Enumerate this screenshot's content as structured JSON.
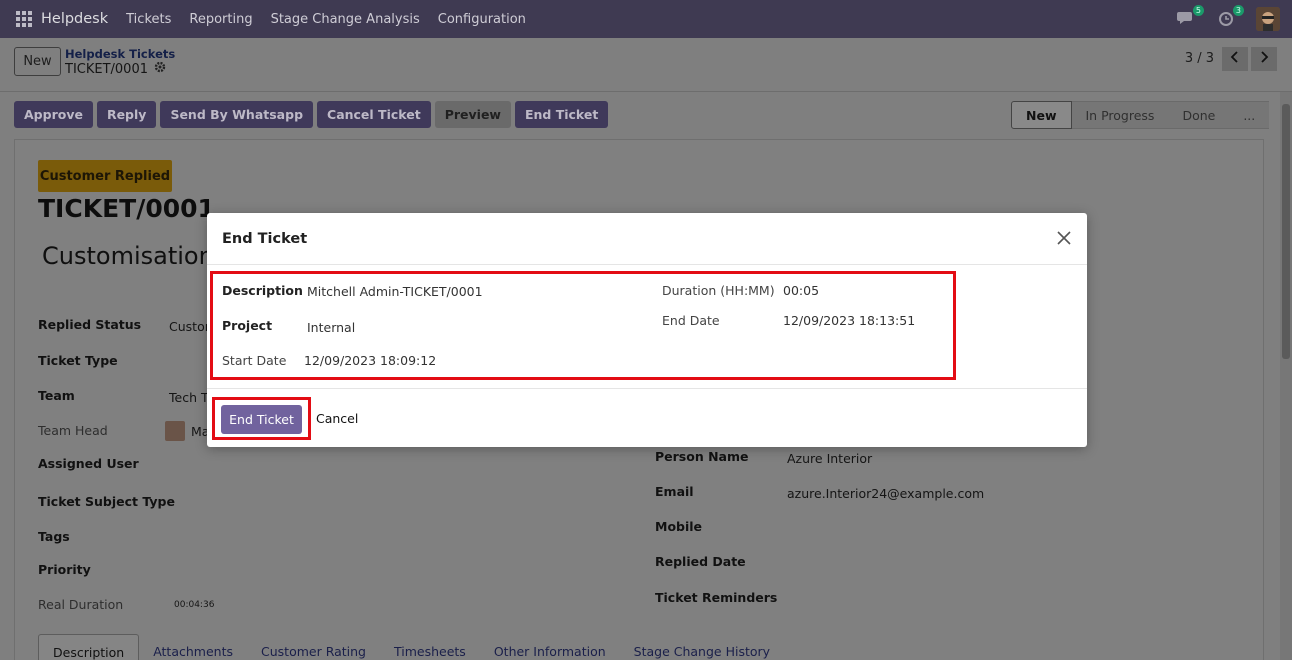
{
  "navbar": {
    "app_name": "Helpdesk",
    "menu": [
      "Tickets",
      "Reporting",
      "Stage Change Analysis",
      "Configuration"
    ],
    "chat_badge": "5",
    "activity_badge": "3"
  },
  "control_panel": {
    "new_label": "New",
    "breadcrumb_parent": "Helpdesk Tickets",
    "breadcrumb_current": "TICKET/0001",
    "pager": "3 / 3"
  },
  "actions": [
    "Approve",
    "Reply",
    "Send By Whatsapp",
    "Cancel Ticket",
    "Preview",
    "End Ticket"
  ],
  "stages": [
    "New",
    "In Progress",
    "Done",
    "..."
  ],
  "form": {
    "status_badge": "Customer Replied",
    "ticket_name": "TICKET/0001",
    "subject": "Customisation",
    "left_fields": {
      "replied_status_label": "Replied Status",
      "replied_status_value": "Custom",
      "ticket_type_label": "Ticket Type",
      "team_label": "Team",
      "team_value": "Tech T",
      "team_head_label": "Team Head",
      "team_head_value": "Ma",
      "assigned_user_label": "Assigned User",
      "subject_type_label": "Ticket Subject Type",
      "tags_label": "Tags",
      "priority_label": "Priority",
      "real_duration_label": "Real Duration",
      "real_duration_value": "00:04:36"
    },
    "right_fields": {
      "person_name_label": "Person Name",
      "person_name_value": "Azure Interior",
      "email_label": "Email",
      "email_value": "azure.Interior24@example.com",
      "mobile_label": "Mobile",
      "replied_date_label": "Replied Date",
      "reminders_label": "Ticket Reminders"
    },
    "tabs": [
      "Description",
      "Attachments",
      "Customer Rating",
      "Timesheets",
      "Other Information",
      "Stage Change History"
    ]
  },
  "modal": {
    "title": "End Ticket",
    "description_label": "Description",
    "description_value": "Mitchell Admin-TICKET/0001",
    "project_label": "Project",
    "project_value": "Internal",
    "start_date_label": "Start Date",
    "start_date_value": "12/09/2023 18:09:12",
    "duration_label": "Duration (HH:MM)",
    "duration_value": "00:05",
    "end_date_label": "End Date",
    "end_date_value": "12/09/2023 18:13:51",
    "end_button": "End Ticket",
    "cancel_button": "Cancel"
  },
  "colors": {
    "navbar": "#3f3a52",
    "primary": "#71639e",
    "highlight": "#e30c14",
    "badge": "#f0a500"
  }
}
